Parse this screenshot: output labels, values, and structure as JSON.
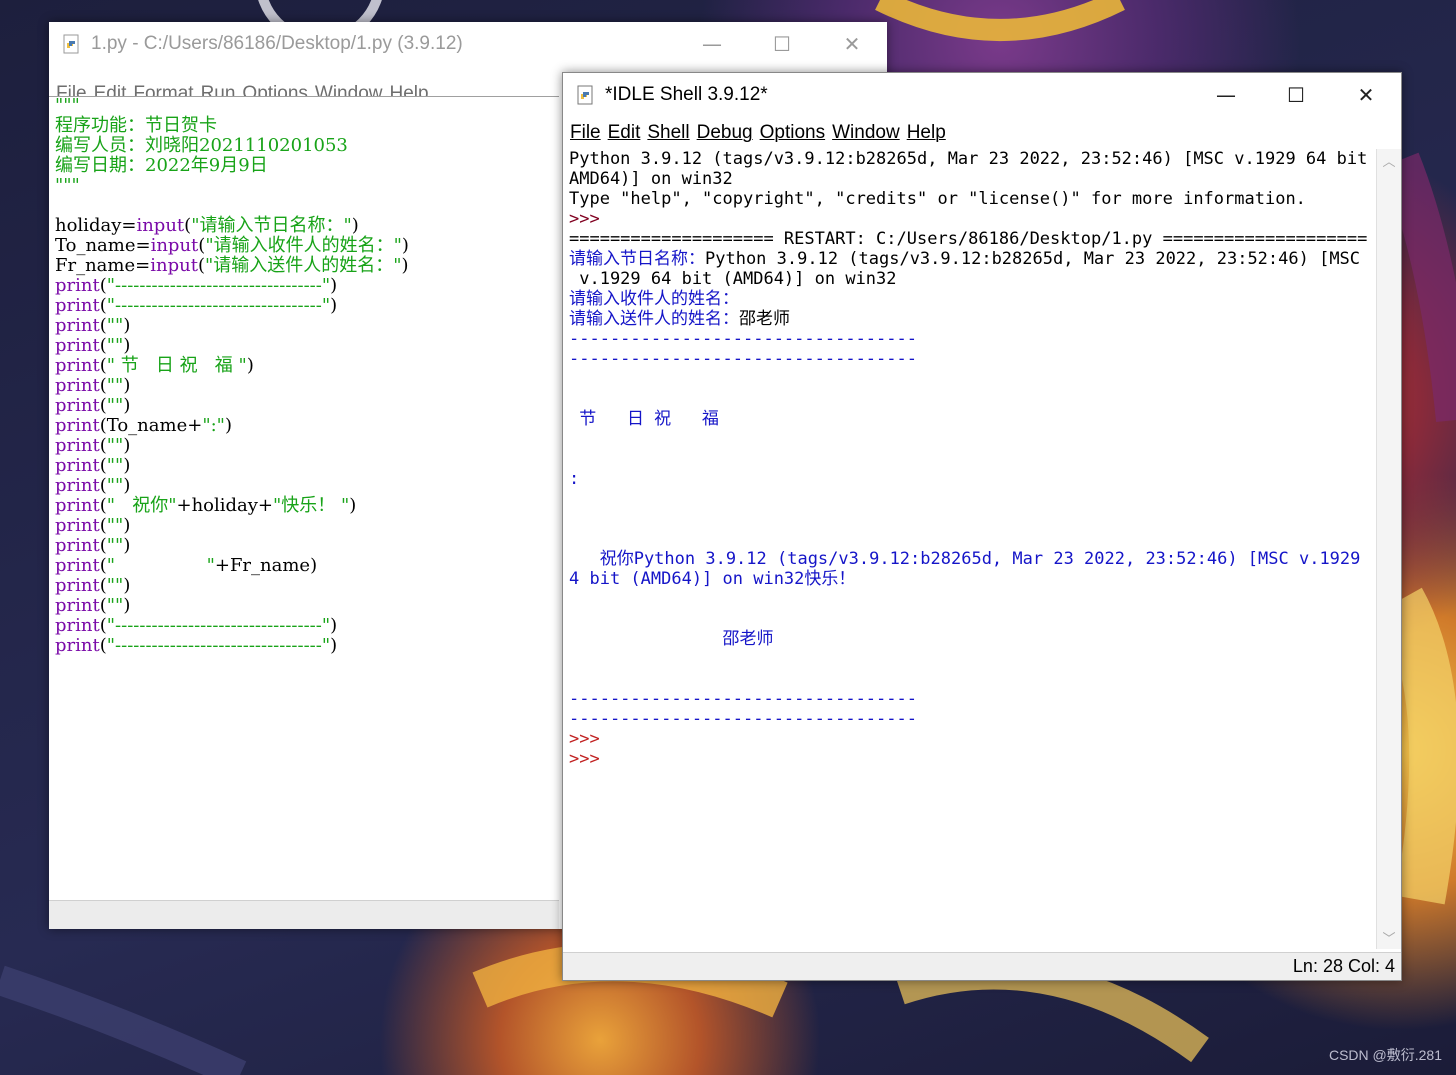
{
  "editor": {
    "title": "1.py - C:/Users/86186/Desktop/1.py (3.9.12)",
    "menu": [
      "File",
      "Edit",
      "Format",
      "Run",
      "Options",
      "Window",
      "Help"
    ],
    "code_lines": [
      [
        {
          "t": "\"\"\"",
          "c": "str"
        }
      ],
      [
        {
          "t": "程序功能：节日贺卡",
          "c": "str"
        }
      ],
      [
        {
          "t": "编写人员：刘晓阳2021110201053",
          "c": "str"
        }
      ],
      [
        {
          "t": "编写日期：2022年9月9日",
          "c": "str"
        }
      ],
      [
        {
          "t": "\"\"\"",
          "c": "str"
        }
      ],
      [
        {
          "t": "",
          "c": "plain"
        }
      ],
      [
        {
          "t": "holiday=",
          "c": "plain"
        },
        {
          "t": "input",
          "c": "kw"
        },
        {
          "t": "(",
          "c": "plain"
        },
        {
          "t": "\"请输入节日名称：\"",
          "c": "str"
        },
        {
          "t": ")",
          "c": "plain"
        }
      ],
      [
        {
          "t": "To_name=",
          "c": "plain"
        },
        {
          "t": "input",
          "c": "kw"
        },
        {
          "t": "(",
          "c": "plain"
        },
        {
          "t": "\"请输入收件人的姓名：\"",
          "c": "str"
        },
        {
          "t": ")",
          "c": "plain"
        }
      ],
      [
        {
          "t": "Fr_name=",
          "c": "plain"
        },
        {
          "t": "input",
          "c": "kw"
        },
        {
          "t": "(",
          "c": "plain"
        },
        {
          "t": "\"请输入送件人的姓名：\"",
          "c": "str"
        },
        {
          "t": ")",
          "c": "plain"
        }
      ],
      [
        {
          "t": "print",
          "c": "kw"
        },
        {
          "t": "(",
          "c": "plain"
        },
        {
          "t": "\"----------------------------------\"",
          "c": "str"
        },
        {
          "t": ")",
          "c": "plain"
        }
      ],
      [
        {
          "t": "print",
          "c": "kw"
        },
        {
          "t": "(",
          "c": "plain"
        },
        {
          "t": "\"----------------------------------\"",
          "c": "str"
        },
        {
          "t": ")",
          "c": "plain"
        }
      ],
      [
        {
          "t": "print",
          "c": "kw"
        },
        {
          "t": "(",
          "c": "plain"
        },
        {
          "t": "\"\"",
          "c": "str"
        },
        {
          "t": ")",
          "c": "plain"
        }
      ],
      [
        {
          "t": "print",
          "c": "kw"
        },
        {
          "t": "(",
          "c": "plain"
        },
        {
          "t": "\"\"",
          "c": "str"
        },
        {
          "t": ")",
          "c": "plain"
        }
      ],
      [
        {
          "t": "print",
          "c": "kw"
        },
        {
          "t": "(",
          "c": "plain"
        },
        {
          "t": "\" 节   日 祝   福 \"",
          "c": "str"
        },
        {
          "t": ")",
          "c": "plain"
        }
      ],
      [
        {
          "t": "print",
          "c": "kw"
        },
        {
          "t": "(",
          "c": "plain"
        },
        {
          "t": "\"\"",
          "c": "str"
        },
        {
          "t": ")",
          "c": "plain"
        }
      ],
      [
        {
          "t": "print",
          "c": "kw"
        },
        {
          "t": "(",
          "c": "plain"
        },
        {
          "t": "\"\"",
          "c": "str"
        },
        {
          "t": ")",
          "c": "plain"
        }
      ],
      [
        {
          "t": "print",
          "c": "kw"
        },
        {
          "t": "(To_name+",
          "c": "plain"
        },
        {
          "t": "\":\"",
          "c": "str"
        },
        {
          "t": ")",
          "c": "plain"
        }
      ],
      [
        {
          "t": "print",
          "c": "kw"
        },
        {
          "t": "(",
          "c": "plain"
        },
        {
          "t": "\"\"",
          "c": "str"
        },
        {
          "t": ")",
          "c": "plain"
        }
      ],
      [
        {
          "t": "print",
          "c": "kw"
        },
        {
          "t": "(",
          "c": "plain"
        },
        {
          "t": "\"\"",
          "c": "str"
        },
        {
          "t": ")",
          "c": "plain"
        }
      ],
      [
        {
          "t": "print",
          "c": "kw"
        },
        {
          "t": "(",
          "c": "plain"
        },
        {
          "t": "\"\"",
          "c": "str"
        },
        {
          "t": ")",
          "c": "plain"
        }
      ],
      [
        {
          "t": "print",
          "c": "kw"
        },
        {
          "t": "(",
          "c": "plain"
        },
        {
          "t": "\"   祝你\"",
          "c": "str"
        },
        {
          "t": "+holiday+",
          "c": "plain"
        },
        {
          "t": "\"快乐！ \"",
          "c": "str"
        },
        {
          "t": ")",
          "c": "plain"
        }
      ],
      [
        {
          "t": "print",
          "c": "kw"
        },
        {
          "t": "(",
          "c": "plain"
        },
        {
          "t": "\"\"",
          "c": "str"
        },
        {
          "t": ")",
          "c": "plain"
        }
      ],
      [
        {
          "t": "print",
          "c": "kw"
        },
        {
          "t": "(",
          "c": "plain"
        },
        {
          "t": "\"\"",
          "c": "str"
        },
        {
          "t": ")",
          "c": "plain"
        }
      ],
      [
        {
          "t": "print",
          "c": "kw"
        },
        {
          "t": "(",
          "c": "plain"
        },
        {
          "t": "\"                \"",
          "c": "str"
        },
        {
          "t": "+Fr_name)",
          "c": "plain"
        }
      ],
      [
        {
          "t": "print",
          "c": "kw"
        },
        {
          "t": "(",
          "c": "plain"
        },
        {
          "t": "\"\"",
          "c": "str"
        },
        {
          "t": ")",
          "c": "plain"
        }
      ],
      [
        {
          "t": "print",
          "c": "kw"
        },
        {
          "t": "(",
          "c": "plain"
        },
        {
          "t": "\"\"",
          "c": "str"
        },
        {
          "t": ")",
          "c": "plain"
        }
      ],
      [
        {
          "t": "print",
          "c": "kw"
        },
        {
          "t": "(",
          "c": "plain"
        },
        {
          "t": "\"----------------------------------\"",
          "c": "str"
        },
        {
          "t": ")",
          "c": "plain"
        }
      ],
      [
        {
          "t": "print",
          "c": "kw"
        },
        {
          "t": "(",
          "c": "plain"
        },
        {
          "t": "\"----------------------------------\"",
          "c": "str"
        },
        {
          "t": ")",
          "c": "plain"
        }
      ]
    ]
  },
  "shell": {
    "title": "*IDLE Shell 3.9.12*",
    "menu": [
      "File",
      "Edit",
      "Shell",
      "Debug",
      "Options",
      "Window",
      "Help"
    ],
    "output_lines": [
      [
        {
          "t": "Python 3.9.12 (tags/v3.9.12:b28265d, Mar 23 2022, 23:52:46) [MSC v.1929 64 bit (",
          "c": "black"
        }
      ],
      [
        {
          "t": "AMD64)] on win32",
          "c": "black"
        }
      ],
      [
        {
          "t": "Type \"help\", \"copyright\", \"credits\" or \"license()\" for more information.",
          "c": "black"
        }
      ],
      [
        {
          "t": ">>> ",
          "c": "maroon"
        }
      ],
      [
        {
          "t": "==================== RESTART: C:/Users/86186/Desktop/1.py ====================",
          "c": "black"
        }
      ],
      [
        {
          "t": "请输入节日名称：",
          "c": "blue"
        },
        {
          "t": "Python 3.9.12 (tags/v3.9.12:b28265d, Mar 23 2022, 23:52:46) [MSC",
          "c": "black"
        }
      ],
      [
        {
          "t": " v.1929 64 bit (AMD64)] on win32",
          "c": "black"
        }
      ],
      [
        {
          "t": "请输入收件人的姓名：",
          "c": "blue"
        }
      ],
      [
        {
          "t": "请输入送件人的姓名：",
          "c": "blue"
        },
        {
          "t": "邵老师",
          "c": "black"
        }
      ],
      [
        {
          "t": "----------------------------------",
          "c": "blue"
        }
      ],
      [
        {
          "t": "----------------------------------",
          "c": "blue"
        }
      ],
      [
        {
          "t": "",
          "c": "blue"
        }
      ],
      [
        {
          "t": "",
          "c": "blue"
        }
      ],
      [
        {
          "t": " 节   日 祝   福 ",
          "c": "blue"
        }
      ],
      [
        {
          "t": "",
          "c": "blue"
        }
      ],
      [
        {
          "t": "",
          "c": "blue"
        }
      ],
      [
        {
          "t": ":",
          "c": "blue"
        }
      ],
      [
        {
          "t": "",
          "c": "blue"
        }
      ],
      [
        {
          "t": "",
          "c": "blue"
        }
      ],
      [
        {
          "t": "",
          "c": "blue"
        }
      ],
      [
        {
          "t": "   祝你Python 3.9.12 (tags/v3.9.12:b28265d, Mar 23 2022, 23:52:46) [MSC v.1929 6",
          "c": "blue"
        }
      ],
      [
        {
          "t": "4 bit (AMD64)] on win32快乐！",
          "c": "blue"
        }
      ],
      [
        {
          "t": "",
          "c": "blue"
        }
      ],
      [
        {
          "t": "",
          "c": "blue"
        }
      ],
      [
        {
          "t": "               邵老师",
          "c": "blue"
        }
      ],
      [
        {
          "t": "",
          "c": "blue"
        }
      ],
      [
        {
          "t": "",
          "c": "blue"
        }
      ],
      [
        {
          "t": "----------------------------------",
          "c": "blue"
        }
      ],
      [
        {
          "t": "----------------------------------",
          "c": "blue"
        }
      ],
      [
        {
          "t": ">>> ",
          "c": "red"
        }
      ],
      [
        {
          "t": ">>> ",
          "c": "red"
        }
      ]
    ],
    "status": "Ln: 28  Col: 4"
  },
  "watermark": "CSDN @敷衍.281",
  "colors": {
    "keyword": "#7a0aa8",
    "string": "#18a318",
    "stdout": "#1515c8",
    "prompt": "#c02020"
  }
}
